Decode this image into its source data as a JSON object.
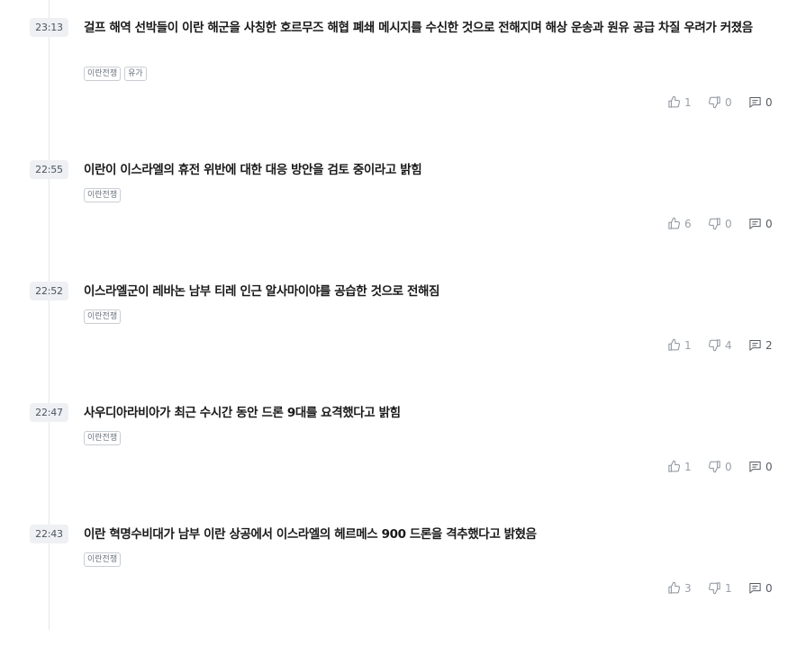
{
  "feed": {
    "items": [
      {
        "time": "23:13",
        "headline": "걸프 해역 선박들이 이란 해군을 사칭한 호르무즈 해협 폐쇄 메시지를 수신한 것으로 전해지며 해상 운송과 원유 공급 차질 우려가 커졌음",
        "tags": [
          "이란전쟁",
          "유가"
        ],
        "likes": "1",
        "dislikes": "0",
        "comments": "0"
      },
      {
        "time": "22:55",
        "headline": "이란이 이스라엘의 휴전 위반에 대한 대응 방안을 검토 중이라고 밝힘",
        "tags": [
          "이란전쟁"
        ],
        "likes": "6",
        "dislikes": "0",
        "comments": "0"
      },
      {
        "time": "22:52",
        "headline": "이스라엘군이 레바논 남부 티레 인근 알사마이야를 공습한 것으로 전해짐",
        "tags": [
          "이란전쟁"
        ],
        "likes": "1",
        "dislikes": "4",
        "comments": "2"
      },
      {
        "time": "22:47",
        "headline": "사우디아라비아가 최근 수시간 동안 드론 9대를 요격했다고 밝힘",
        "tags": [
          "이란전쟁"
        ],
        "likes": "1",
        "dislikes": "0",
        "comments": "0"
      },
      {
        "time": "22:43",
        "headline": "이란 혁명수비대가 남부 이란 상공에서 이스라엘의 헤르메스 900 드론을 격추했다고 밝혔음",
        "tags": [
          "이란전쟁"
        ],
        "likes": "3",
        "dislikes": "1",
        "comments": "0"
      }
    ]
  },
  "icons": {
    "like": "thumbs-up-icon",
    "dislike": "thumbs-down-icon",
    "comment": "comment-icon"
  },
  "colors": {
    "icon": "#8a9099",
    "timeline": "#e6e7ea",
    "time_badge_bg": "#eef0f3"
  }
}
